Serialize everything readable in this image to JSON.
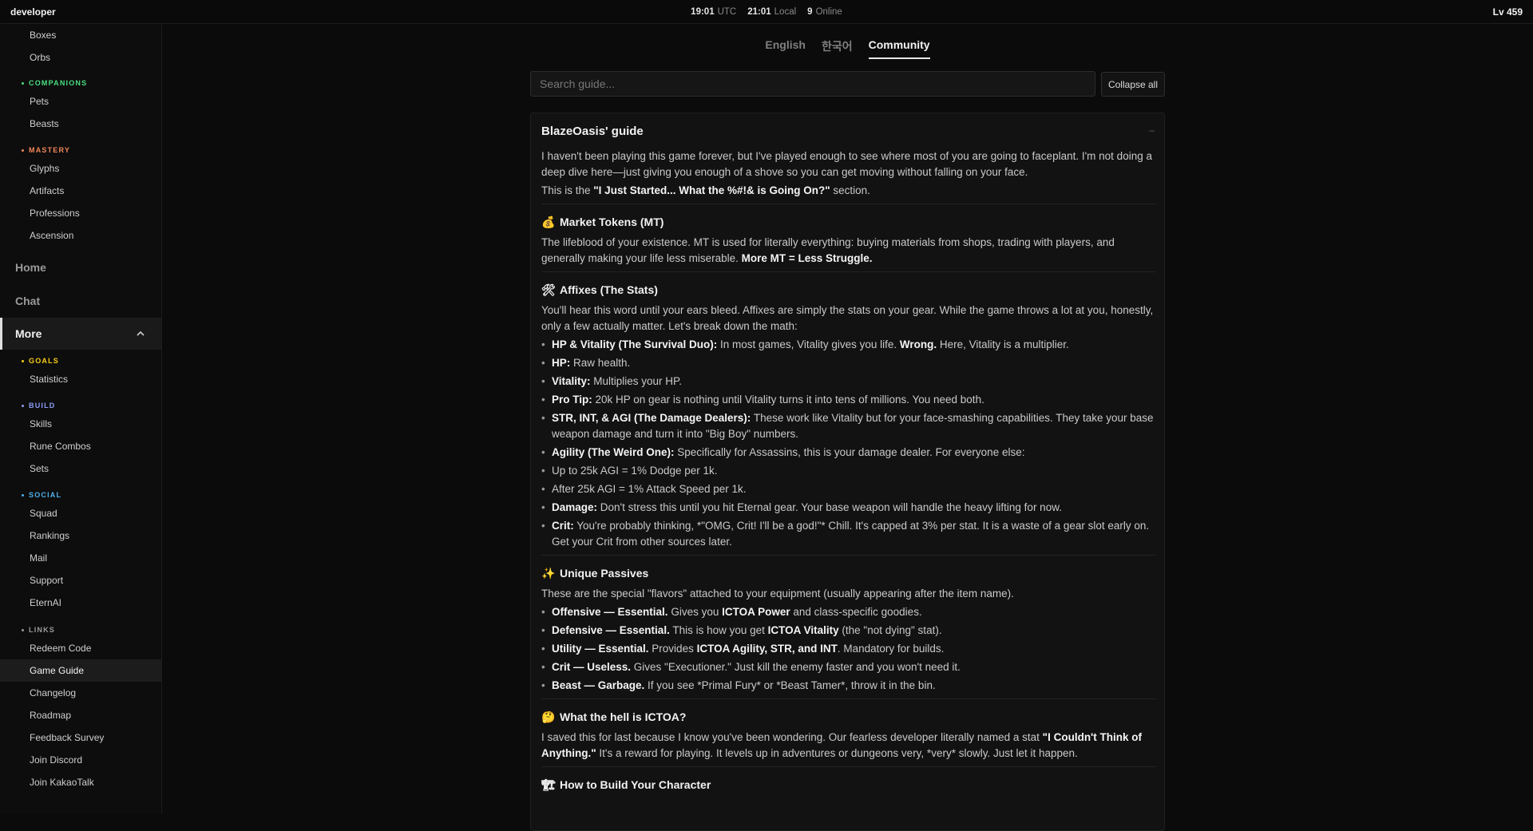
{
  "topbar": {
    "brand": "developer",
    "utc_time": "19:01",
    "utc_label": "UTC",
    "local_time": "21:01",
    "local_label": "Local",
    "online_count": "9",
    "online_label": "Online",
    "level": "Lv 459"
  },
  "sidebar": {
    "top_items": [
      "Boxes",
      "Orbs"
    ],
    "companions": {
      "label": "COMPANIONS",
      "color": "#4ade80",
      "items": [
        "Pets",
        "Beasts"
      ]
    },
    "mastery": {
      "label": "MASTERY",
      "color": "#f0855a",
      "items": [
        "Glyphs",
        "Artifacts",
        "Professions",
        "Ascension"
      ]
    },
    "main": [
      "Home",
      "Chat"
    ],
    "more": "More",
    "goals": {
      "label": "GOALS",
      "color": "#facc15",
      "items": [
        "Statistics"
      ]
    },
    "build": {
      "label": "BUILD",
      "color": "#8b9cf5",
      "items": [
        "Skills",
        "Rune Combos",
        "Sets"
      ]
    },
    "social": {
      "label": "SOCIAL",
      "color": "#4fb0ea",
      "items": [
        "Squad",
        "Rankings",
        "Mail",
        "Support",
        "EternAI"
      ]
    },
    "links": {
      "label": "LINKS",
      "color": "#9a9a9a",
      "items": [
        "Redeem Code",
        "Game Guide",
        "Changelog",
        "Roadmap",
        "Feedback Survey",
        "Join Discord",
        "Join KakaoTalk"
      ]
    }
  },
  "tabs": [
    "English",
    "한국어",
    "Community"
  ],
  "search": {
    "placeholder": "Search guide..."
  },
  "collapse_all": "Collapse all",
  "guide": {
    "title": "BlazeOasis' guide",
    "collapse_symbol": "–",
    "intro_1": "I haven't been playing this game forever, but I've played enough to see where most of you are going to faceplant. I'm not doing a deep dive here—just giving you enough of a shove so you can get moving without falling on your face.",
    "intro_2a": "This is the ",
    "intro_2b": "\"I Just Started... What the %#!& is Going On?\"",
    "intro_2c": " section.",
    "mt_icon": "💰",
    "mt_title": "Market Tokens (MT)",
    "mt_text": "The lifeblood of your existence. MT is used for literally everything: buying materials from shops, trading with players, and generally making your life less miserable. ",
    "mt_bold": "More MT = Less Struggle.",
    "affix_icon": "🛠",
    "affix_title": "Affixes (The Stats)",
    "affix_text": "You'll hear this word until your ears bleed. Affixes are simply the stats on your gear. While the game throws a lot at you, honestly, only a few actually matter. Let's break down the math:",
    "affix_list": [
      {
        "b": "HP & Vitality (The Survival Duo):",
        "t": " In most games, Vitality gives you life. ",
        "b2": "Wrong.",
        "t2": " Here, Vitality is a multiplier."
      },
      {
        "b": "HP:",
        "t": " Raw health.",
        "b2": "",
        "t2": ""
      },
      {
        "b": "Vitality:",
        "t": " Multiplies your HP.",
        "b2": "",
        "t2": ""
      },
      {
        "b": "Pro Tip:",
        "t": " 20k HP on gear is nothing until Vitality turns it into tens of millions. You need both.",
        "b2": "",
        "t2": ""
      },
      {
        "b": "STR, INT, & AGI (The Damage Dealers):",
        "t": " These work like Vitality but for your face-smashing capabilities. They take your base weapon damage and turn it into \"Big Boy\" numbers.",
        "b2": "",
        "t2": ""
      },
      {
        "b": "Agility (The Weird One):",
        "t": " Specifically for Assassins, this is your damage dealer. For everyone else:",
        "b2": "",
        "t2": ""
      },
      {
        "b": "",
        "t": "Up to 25k AGI = 1% Dodge per 1k.",
        "b2": "",
        "t2": ""
      },
      {
        "b": "",
        "t": "After 25k AGI = 1% Attack Speed per 1k.",
        "b2": "",
        "t2": ""
      },
      {
        "b": "Damage:",
        "t": " Don't stress this until you hit Eternal gear. Your base weapon will handle the heavy lifting for now.",
        "b2": "",
        "t2": ""
      },
      {
        "b": "Crit:",
        "t": " You're probably thinking, *\"OMG, Crit! I'll be a god!\"* Chill. It's capped at 3% per stat. It is a waste of a gear slot early on. Get your Crit from other sources later.",
        "b2": "",
        "t2": ""
      }
    ],
    "passive_icon": "✨",
    "passive_title": "Unique Passives",
    "passive_text": "These are the special \"flavors\" attached to your equipment (usually appearing after the item name).",
    "passive_list": [
      {
        "b": "Offensive — Essential.",
        "t": " Gives you ",
        "b2": "ICTOA Power",
        "t2": " and class-specific goodies."
      },
      {
        "b": "Defensive — Essential.",
        "t": " This is how you get ",
        "b2": "ICTOA Vitality",
        "t2": " (the \"not dying\" stat)."
      },
      {
        "b": "Utility — Essential.",
        "t": " Provides ",
        "b2": "ICTOA Agility, STR, and INT",
        "t2": ". Mandatory for builds."
      },
      {
        "b": "Crit — Useless.",
        "t": " Gives \"Executioner.\" Just kill the enemy faster and you won't need it.",
        "b2": "",
        "t2": ""
      },
      {
        "b": "Beast — Garbage.",
        "t": " If you see *Primal Fury* or *Beast Tamer*, throw it in the bin.",
        "b2": "",
        "t2": ""
      }
    ],
    "ictoa_icon": "🤔",
    "ictoa_title": "What the hell is ICTOA?",
    "ictoa_text_1": "I saved this for last because I know you've been wondering. Our fearless developer literally named a stat ",
    "ictoa_bold": "\"I Couldn't Think of Anything.\"",
    "ictoa_text_2": " It's a reward for playing. It levels up in adventures or dungeons very, *very* slowly. Just let it happen.",
    "build_icon": "🏗",
    "build_title": "How to Build Your Character"
  }
}
